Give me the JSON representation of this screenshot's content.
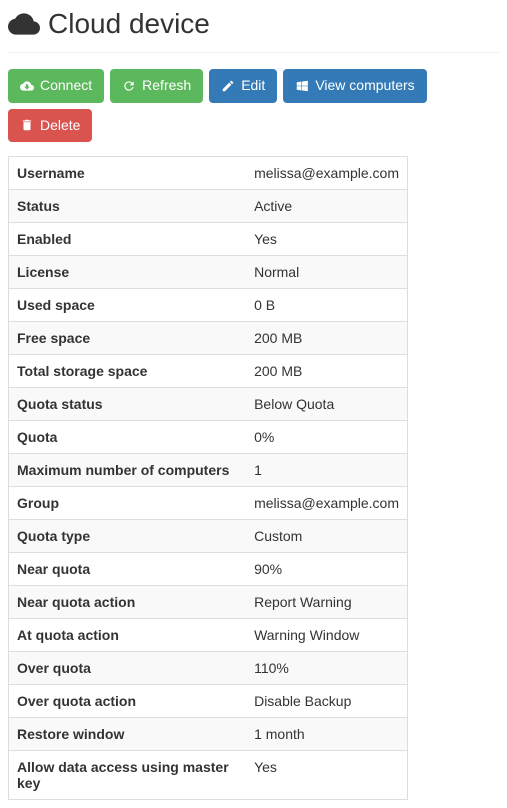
{
  "header": {
    "title": "Cloud device"
  },
  "toolbar": {
    "connect_label": "Connect",
    "refresh_label": "Refresh",
    "edit_label": "Edit",
    "view_computers_label": "View computers",
    "delete_label": "Delete"
  },
  "details": {
    "rows": [
      {
        "label": "Username",
        "value": "melissa@example.com"
      },
      {
        "label": "Status",
        "value": "Active"
      },
      {
        "label": "Enabled",
        "value": "Yes"
      },
      {
        "label": "License",
        "value": "Normal"
      },
      {
        "label": "Used space",
        "value": "0 B"
      },
      {
        "label": "Free space",
        "value": "200 MB"
      },
      {
        "label": "Total storage space",
        "value": "200 MB"
      },
      {
        "label": "Quota status",
        "value": "Below Quota"
      },
      {
        "label": "Quota",
        "value": "0%"
      },
      {
        "label": "Maximum number of computers",
        "value": "1"
      },
      {
        "label": "Group",
        "value": "melissa@example.com"
      },
      {
        "label": "Quota type",
        "value": "Custom"
      },
      {
        "label": "Near quota",
        "value": "90%"
      },
      {
        "label": "Near quota action",
        "value": "Report Warning"
      },
      {
        "label": "At quota action",
        "value": "Warning Window"
      },
      {
        "label": "Over quota",
        "value": "110%"
      },
      {
        "label": "Over quota action",
        "value": "Disable Backup"
      },
      {
        "label": "Restore window",
        "value": "1 month"
      },
      {
        "label": "Allow data access using master key",
        "value": "Yes"
      }
    ]
  }
}
